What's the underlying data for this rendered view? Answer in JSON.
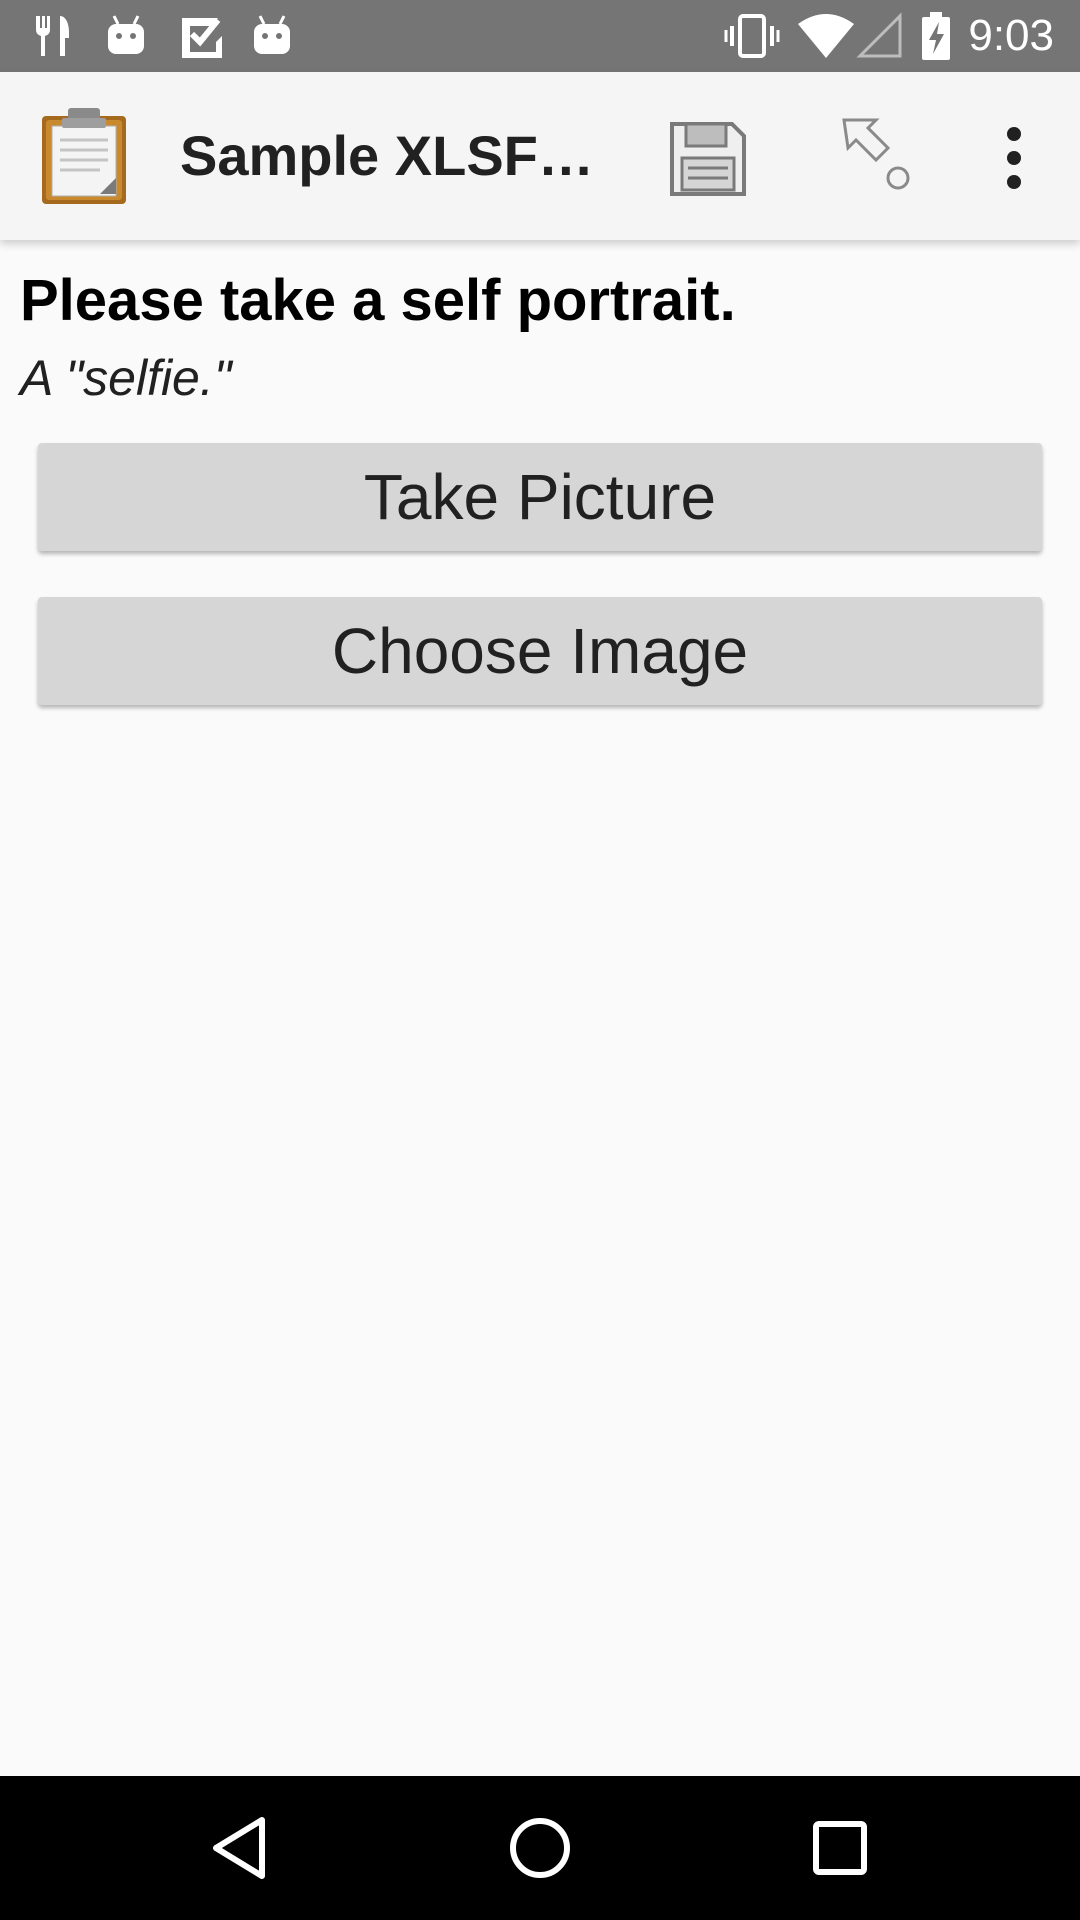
{
  "status_bar": {
    "time": "9:03",
    "left_icons": [
      "fork-knife-icon",
      "android-icon",
      "checkmark-box-icon",
      "android-icon"
    ],
    "right_icons": [
      "vibrate-icon",
      "wifi-icon",
      "signal-icon",
      "battery-charging-icon"
    ]
  },
  "app_bar": {
    "title": "Sample XLSForm",
    "actions": [
      "save-icon",
      "jump-icon",
      "overflow-menu-icon"
    ]
  },
  "question": {
    "label": "Please take a self portrait.",
    "hint": "A \"selfie.\""
  },
  "buttons": {
    "take_picture": "Take Picture",
    "choose_image": "Choose Image"
  },
  "nav_bar": {
    "buttons": [
      "back-icon",
      "home-icon",
      "recents-icon"
    ]
  },
  "colors": {
    "status_bar": "#757575",
    "app_bar": "#f5f5f5",
    "background": "#fafafa",
    "button": "#d6d6d6",
    "nav_bar": "#000000"
  }
}
